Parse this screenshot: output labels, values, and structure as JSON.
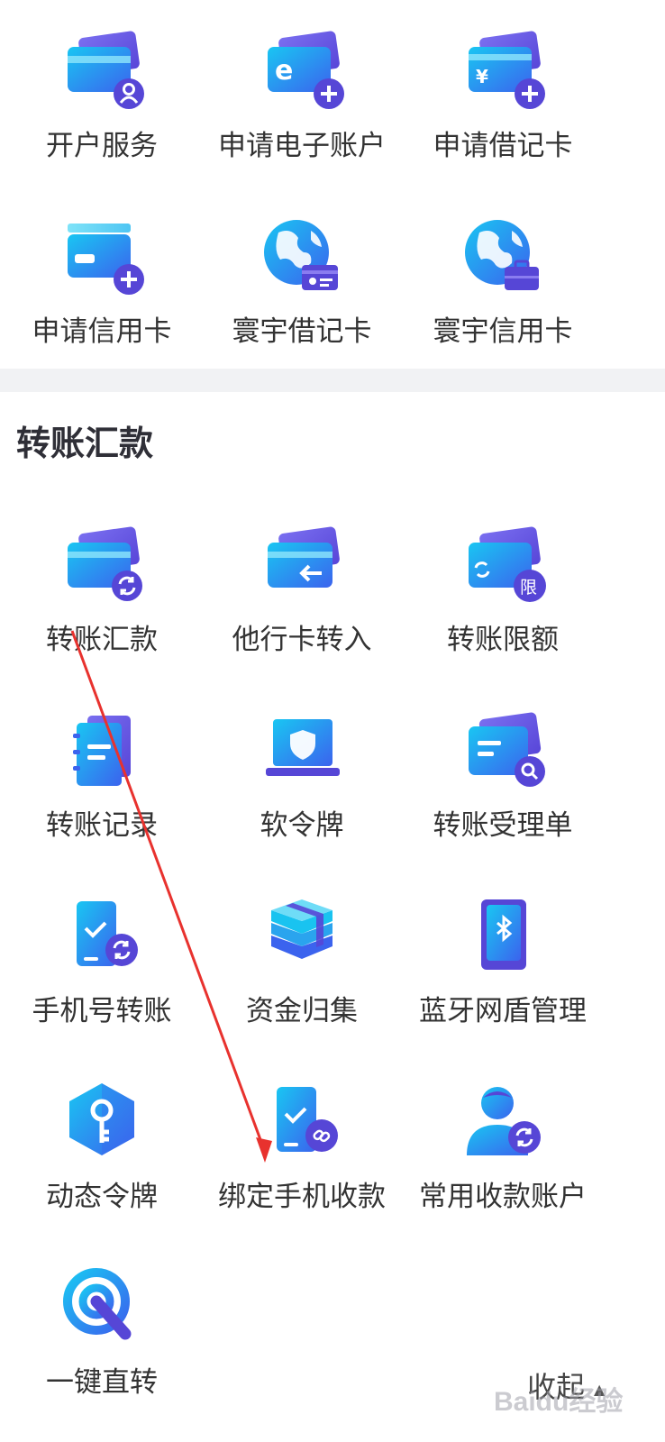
{
  "open_account_section": {
    "items": [
      {
        "label": "开户服务",
        "icon": "card-user-icon"
      },
      {
        "label": "申请电子账户",
        "icon": "card-e-plus-icon"
      },
      {
        "label": "申请借记卡",
        "icon": "card-yen-plus-icon"
      },
      {
        "label": "申请信用卡",
        "icon": "card-plus-icon"
      },
      {
        "label": "寰宇借记卡",
        "icon": "globe-id-card-icon"
      },
      {
        "label": "寰宇信用卡",
        "icon": "globe-briefcase-icon"
      }
    ]
  },
  "transfer_section": {
    "title": "转账汇款",
    "items": [
      {
        "label": "转账汇款",
        "icon": "card-refresh-icon"
      },
      {
        "label": "他行卡转入",
        "icon": "card-arrow-left-icon"
      },
      {
        "label": "转账限额",
        "icon": "card-limit-icon"
      },
      {
        "label": "转账记录",
        "icon": "notebook-icon"
      },
      {
        "label": "软令牌",
        "icon": "laptop-shield-icon"
      },
      {
        "label": "转账受理单",
        "icon": "card-search-icon"
      },
      {
        "label": "手机号转账",
        "icon": "phone-refresh-icon"
      },
      {
        "label": "资金归集",
        "icon": "money-stack-icon"
      },
      {
        "label": "蓝牙网盾管理",
        "icon": "bluetooth-device-icon"
      },
      {
        "label": "动态令牌",
        "icon": "hexagon-key-icon"
      },
      {
        "label": "绑定手机收款",
        "icon": "phone-link-icon"
      },
      {
        "label": "常用收款账户",
        "icon": "user-refresh-icon"
      },
      {
        "label": "一键直转",
        "icon": "target-tap-icon"
      }
    ],
    "collapse_label": "收起"
  },
  "colors": {
    "icon_gradient_start": "#19c3f0",
    "icon_gradient_end": "#3d6cf0",
    "icon_badge": "#5646d6",
    "annotation_arrow": "#e8322e",
    "section_band": "#f1f2f4"
  },
  "watermark": "Baidu经验"
}
